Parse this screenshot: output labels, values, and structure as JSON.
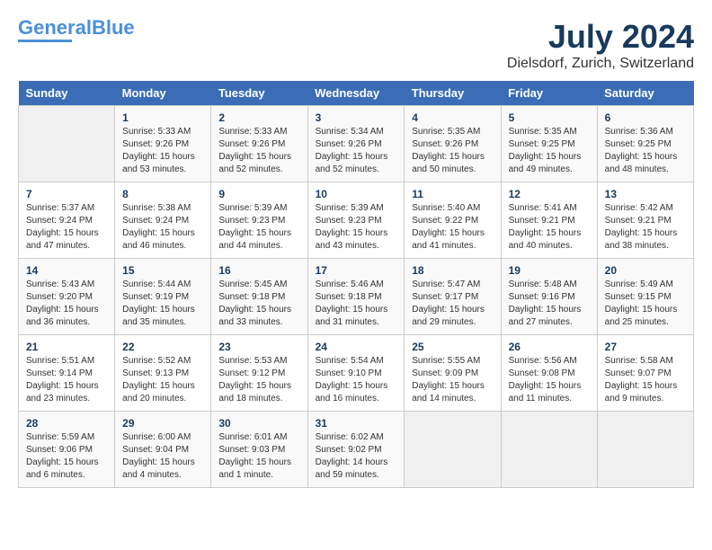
{
  "logo": {
    "line1": "General",
    "line2": "Blue"
  },
  "title": "July 2024",
  "location": "Dielsdorf, Zurich, Switzerland",
  "headers": [
    "Sunday",
    "Monday",
    "Tuesday",
    "Wednesday",
    "Thursday",
    "Friday",
    "Saturday"
  ],
  "weeks": [
    [
      {
        "day": "",
        "info": ""
      },
      {
        "day": "1",
        "info": "Sunrise: 5:33 AM\nSunset: 9:26 PM\nDaylight: 15 hours\nand 53 minutes."
      },
      {
        "day": "2",
        "info": "Sunrise: 5:33 AM\nSunset: 9:26 PM\nDaylight: 15 hours\nand 52 minutes."
      },
      {
        "day": "3",
        "info": "Sunrise: 5:34 AM\nSunset: 9:26 PM\nDaylight: 15 hours\nand 52 minutes."
      },
      {
        "day": "4",
        "info": "Sunrise: 5:35 AM\nSunset: 9:26 PM\nDaylight: 15 hours\nand 50 minutes."
      },
      {
        "day": "5",
        "info": "Sunrise: 5:35 AM\nSunset: 9:25 PM\nDaylight: 15 hours\nand 49 minutes."
      },
      {
        "day": "6",
        "info": "Sunrise: 5:36 AM\nSunset: 9:25 PM\nDaylight: 15 hours\nand 48 minutes."
      }
    ],
    [
      {
        "day": "7",
        "info": "Sunrise: 5:37 AM\nSunset: 9:24 PM\nDaylight: 15 hours\nand 47 minutes."
      },
      {
        "day": "8",
        "info": "Sunrise: 5:38 AM\nSunset: 9:24 PM\nDaylight: 15 hours\nand 46 minutes."
      },
      {
        "day": "9",
        "info": "Sunrise: 5:39 AM\nSunset: 9:23 PM\nDaylight: 15 hours\nand 44 minutes."
      },
      {
        "day": "10",
        "info": "Sunrise: 5:39 AM\nSunset: 9:23 PM\nDaylight: 15 hours\nand 43 minutes."
      },
      {
        "day": "11",
        "info": "Sunrise: 5:40 AM\nSunset: 9:22 PM\nDaylight: 15 hours\nand 41 minutes."
      },
      {
        "day": "12",
        "info": "Sunrise: 5:41 AM\nSunset: 9:21 PM\nDaylight: 15 hours\nand 40 minutes."
      },
      {
        "day": "13",
        "info": "Sunrise: 5:42 AM\nSunset: 9:21 PM\nDaylight: 15 hours\nand 38 minutes."
      }
    ],
    [
      {
        "day": "14",
        "info": "Sunrise: 5:43 AM\nSunset: 9:20 PM\nDaylight: 15 hours\nand 36 minutes."
      },
      {
        "day": "15",
        "info": "Sunrise: 5:44 AM\nSunset: 9:19 PM\nDaylight: 15 hours\nand 35 minutes."
      },
      {
        "day": "16",
        "info": "Sunrise: 5:45 AM\nSunset: 9:18 PM\nDaylight: 15 hours\nand 33 minutes."
      },
      {
        "day": "17",
        "info": "Sunrise: 5:46 AM\nSunset: 9:18 PM\nDaylight: 15 hours\nand 31 minutes."
      },
      {
        "day": "18",
        "info": "Sunrise: 5:47 AM\nSunset: 9:17 PM\nDaylight: 15 hours\nand 29 minutes."
      },
      {
        "day": "19",
        "info": "Sunrise: 5:48 AM\nSunset: 9:16 PM\nDaylight: 15 hours\nand 27 minutes."
      },
      {
        "day": "20",
        "info": "Sunrise: 5:49 AM\nSunset: 9:15 PM\nDaylight: 15 hours\nand 25 minutes."
      }
    ],
    [
      {
        "day": "21",
        "info": "Sunrise: 5:51 AM\nSunset: 9:14 PM\nDaylight: 15 hours\nand 23 minutes."
      },
      {
        "day": "22",
        "info": "Sunrise: 5:52 AM\nSunset: 9:13 PM\nDaylight: 15 hours\nand 20 minutes."
      },
      {
        "day": "23",
        "info": "Sunrise: 5:53 AM\nSunset: 9:12 PM\nDaylight: 15 hours\nand 18 minutes."
      },
      {
        "day": "24",
        "info": "Sunrise: 5:54 AM\nSunset: 9:10 PM\nDaylight: 15 hours\nand 16 minutes."
      },
      {
        "day": "25",
        "info": "Sunrise: 5:55 AM\nSunset: 9:09 PM\nDaylight: 15 hours\nand 14 minutes."
      },
      {
        "day": "26",
        "info": "Sunrise: 5:56 AM\nSunset: 9:08 PM\nDaylight: 15 hours\nand 11 minutes."
      },
      {
        "day": "27",
        "info": "Sunrise: 5:58 AM\nSunset: 9:07 PM\nDaylight: 15 hours\nand 9 minutes."
      }
    ],
    [
      {
        "day": "28",
        "info": "Sunrise: 5:59 AM\nSunset: 9:06 PM\nDaylight: 15 hours\nand 6 minutes."
      },
      {
        "day": "29",
        "info": "Sunrise: 6:00 AM\nSunset: 9:04 PM\nDaylight: 15 hours\nand 4 minutes."
      },
      {
        "day": "30",
        "info": "Sunrise: 6:01 AM\nSunset: 9:03 PM\nDaylight: 15 hours\nand 1 minute."
      },
      {
        "day": "31",
        "info": "Sunrise: 6:02 AM\nSunset: 9:02 PM\nDaylight: 14 hours\nand 59 minutes."
      },
      {
        "day": "",
        "info": ""
      },
      {
        "day": "",
        "info": ""
      },
      {
        "day": "",
        "info": ""
      }
    ]
  ]
}
